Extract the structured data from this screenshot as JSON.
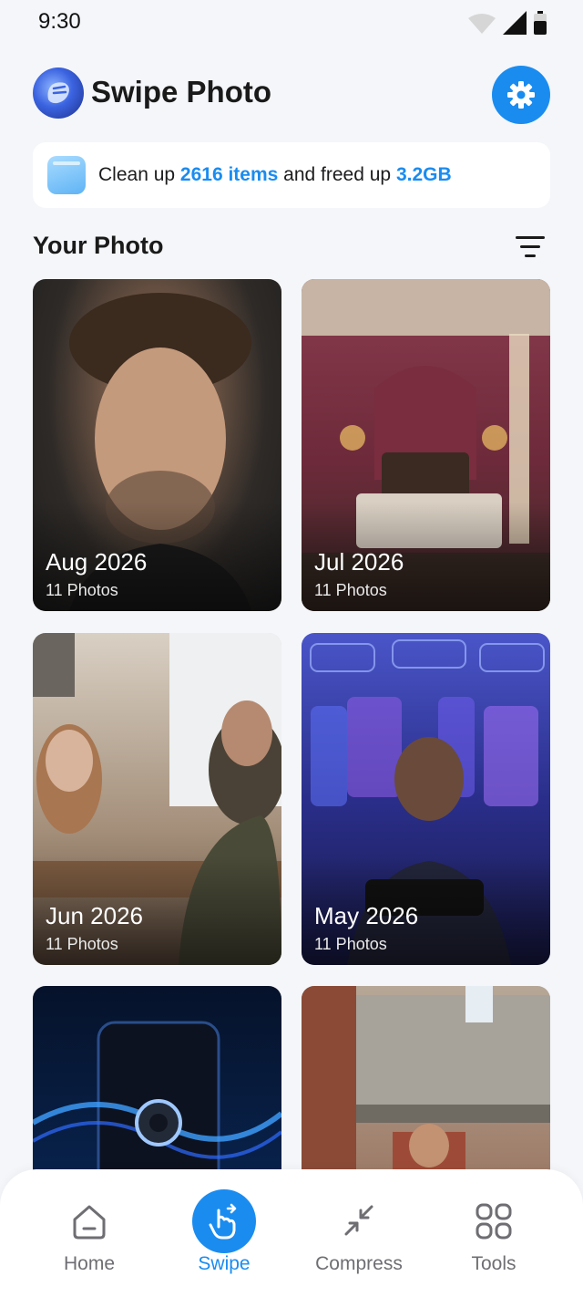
{
  "status_bar": {
    "time": "9:30"
  },
  "header": {
    "title": "Swipe Photo"
  },
  "cleanup": {
    "prefix": "Clean up ",
    "items": "2616 items",
    "middle": " and freed up ",
    "size": "3.2GB"
  },
  "section": {
    "title": "Your Photo"
  },
  "albums": [
    {
      "month": "Aug 2026",
      "count": "11 Photos"
    },
    {
      "month": "Jul 2026",
      "count": "11 Photos"
    },
    {
      "month": "Jun 2026",
      "count": "11 Photos"
    },
    {
      "month": "May 2026",
      "count": "11 Photos"
    },
    {
      "month": "",
      "count": ""
    },
    {
      "month": "",
      "count": ""
    }
  ],
  "nav": {
    "home": "Home",
    "swipe": "Swipe",
    "compress": "Compress",
    "tools": "Tools",
    "active": "swipe"
  },
  "colors": {
    "accent": "#1a8cf0",
    "background": "#f4f6f9"
  }
}
